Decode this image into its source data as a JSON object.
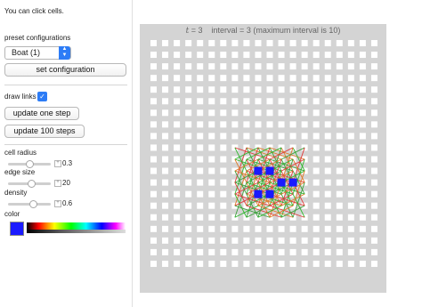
{
  "hint": "You can click cells.",
  "preset_label": "preset configurations",
  "preset_value": "Boat (1)",
  "set_button": "set configuration",
  "draw_links_label": "draw links",
  "draw_links_checked": true,
  "update_one": "update one step",
  "update_100": "update 100 steps",
  "sliders": [
    {
      "label": "cell radius",
      "value": "0.3",
      "level": 0.5
    },
    {
      "label": "edge size",
      "value": "20",
      "level": 0.55
    },
    {
      "label": "density",
      "value": "0.6",
      "level": 0.6
    }
  ],
  "color_label": "color",
  "selected_color": "#1a1aff",
  "caption": {
    "t_symbol": "t",
    "t_eq": " = 3",
    "interval": "interval = 3 (maximum interval is 10)"
  },
  "grid": {
    "cols": 20,
    "rows": 20,
    "cell_color": "#ffffff",
    "active_color": "#1a1aff",
    "active_cells": [
      [
        9,
        11
      ],
      [
        10,
        11
      ],
      [
        12,
        12
      ],
      [
        9,
        13
      ],
      [
        10,
        13
      ],
      [
        11,
        12
      ]
    ]
  }
}
